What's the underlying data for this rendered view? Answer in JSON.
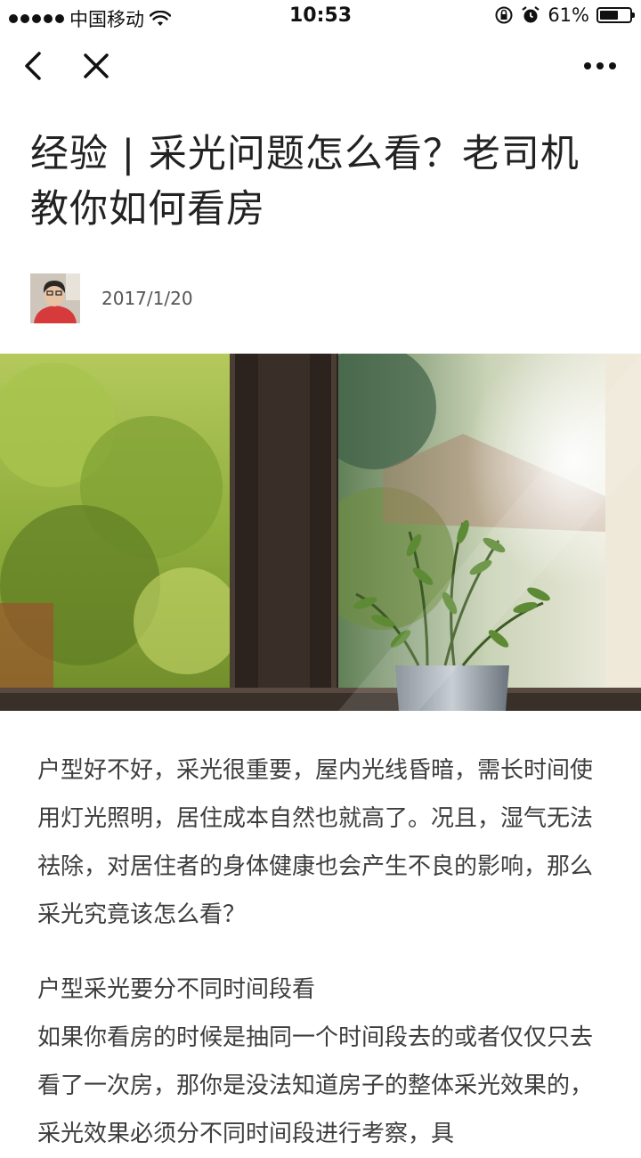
{
  "status_bar": {
    "carrier": "中国移动",
    "time": "10:53",
    "battery_percent": "61%",
    "battery_level": 0.61
  },
  "nav": {
    "back_icon": "chevron-left-icon",
    "close_icon": "close-icon",
    "more_icon": "more-dots-icon"
  },
  "article": {
    "title": "经验 | 采光问题怎么看？老司机教你如何看房",
    "date": "2017/1/20",
    "paragraph_1": "户型好不好，采光很重要，屋内光线昏暗，需长时间使用灯光照明，居住成本自然也就高了。况且，湿气无法祛除，对居住者的身体健康也会产生不良的影响，那么采光究竟该怎么看？",
    "section_heading": "户型采光要分不同时间段看",
    "paragraph_2": "如果你看房的时候是抽同一个时间段去的或者仅仅只去看了一次房，那你是没法知道房子的整体采光效果的，采光效果必须分不同时间段进行考察，具"
  },
  "colors": {
    "text": "#3e3e3e",
    "title": "#222222",
    "meta": "#555555"
  }
}
